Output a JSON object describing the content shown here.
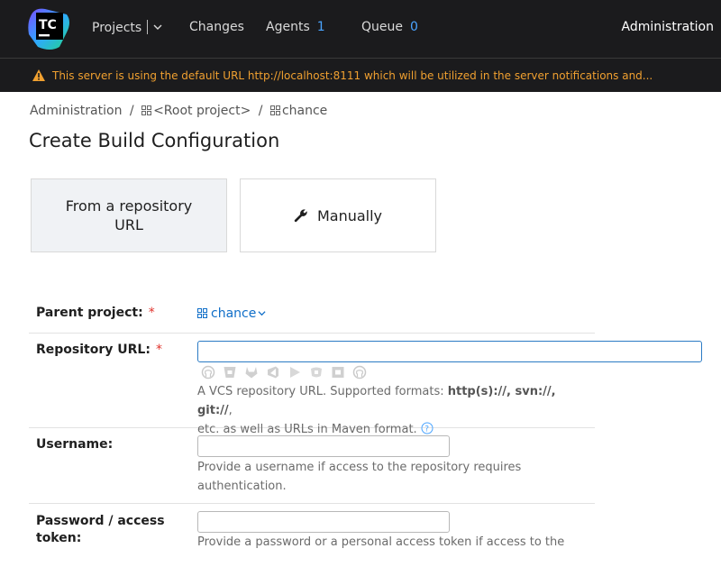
{
  "topbar": {
    "logo_text": "TC",
    "nav": [
      {
        "label": "Projects",
        "count": ""
      },
      {
        "label": "Changes",
        "count": ""
      },
      {
        "label": "Agents",
        "count": "1"
      },
      {
        "label": "Queue",
        "count": "0"
      }
    ],
    "admin_label": "Administration"
  },
  "warning": {
    "text": "This server is using the default URL http://localhost:8111 which will be utilized in the server notifications and..."
  },
  "breadcrumb": {
    "items": [
      "Administration",
      "<Root project>",
      "chance"
    ],
    "separator": "/"
  },
  "page_title": "Create Build Configuration",
  "mode_tabs": {
    "from_repo": "From a repository URL",
    "manually": "Manually"
  },
  "form": {
    "parent_project": {
      "label": "Parent project:",
      "required": "*",
      "value": "chance"
    },
    "repository_url": {
      "label": "Repository URL:",
      "required": "*",
      "value": "",
      "vcs_icons": [
        "github-icon",
        "bitbucket-icon",
        "gitlab-icon",
        "azure-devops-icon",
        "jetbrains-space-icon",
        "perforce-icon",
        "bitbucket-server-icon",
        "github-enterprise-icon"
      ],
      "help_prefix": "A VCS repository URL. Supported formats: ",
      "help_formats": "http(s)://, svn://, git://",
      "help_suffix_1": ",",
      "help_suffix_2": "etc. as well as URLs in Maven format."
    },
    "username": {
      "label": "Username:",
      "value": "",
      "help": "Provide a username if access to the repository requires authentication."
    },
    "password": {
      "label": "Password / access token:",
      "value": "",
      "help": "Provide a password or a personal access token if access to the"
    }
  },
  "colors": {
    "topbar_bg": "#1b1b1d",
    "warning_text": "#f0a030",
    "link": "#0f6ec8",
    "required": "#e0322b",
    "nav_count": "#4aa4ff"
  }
}
